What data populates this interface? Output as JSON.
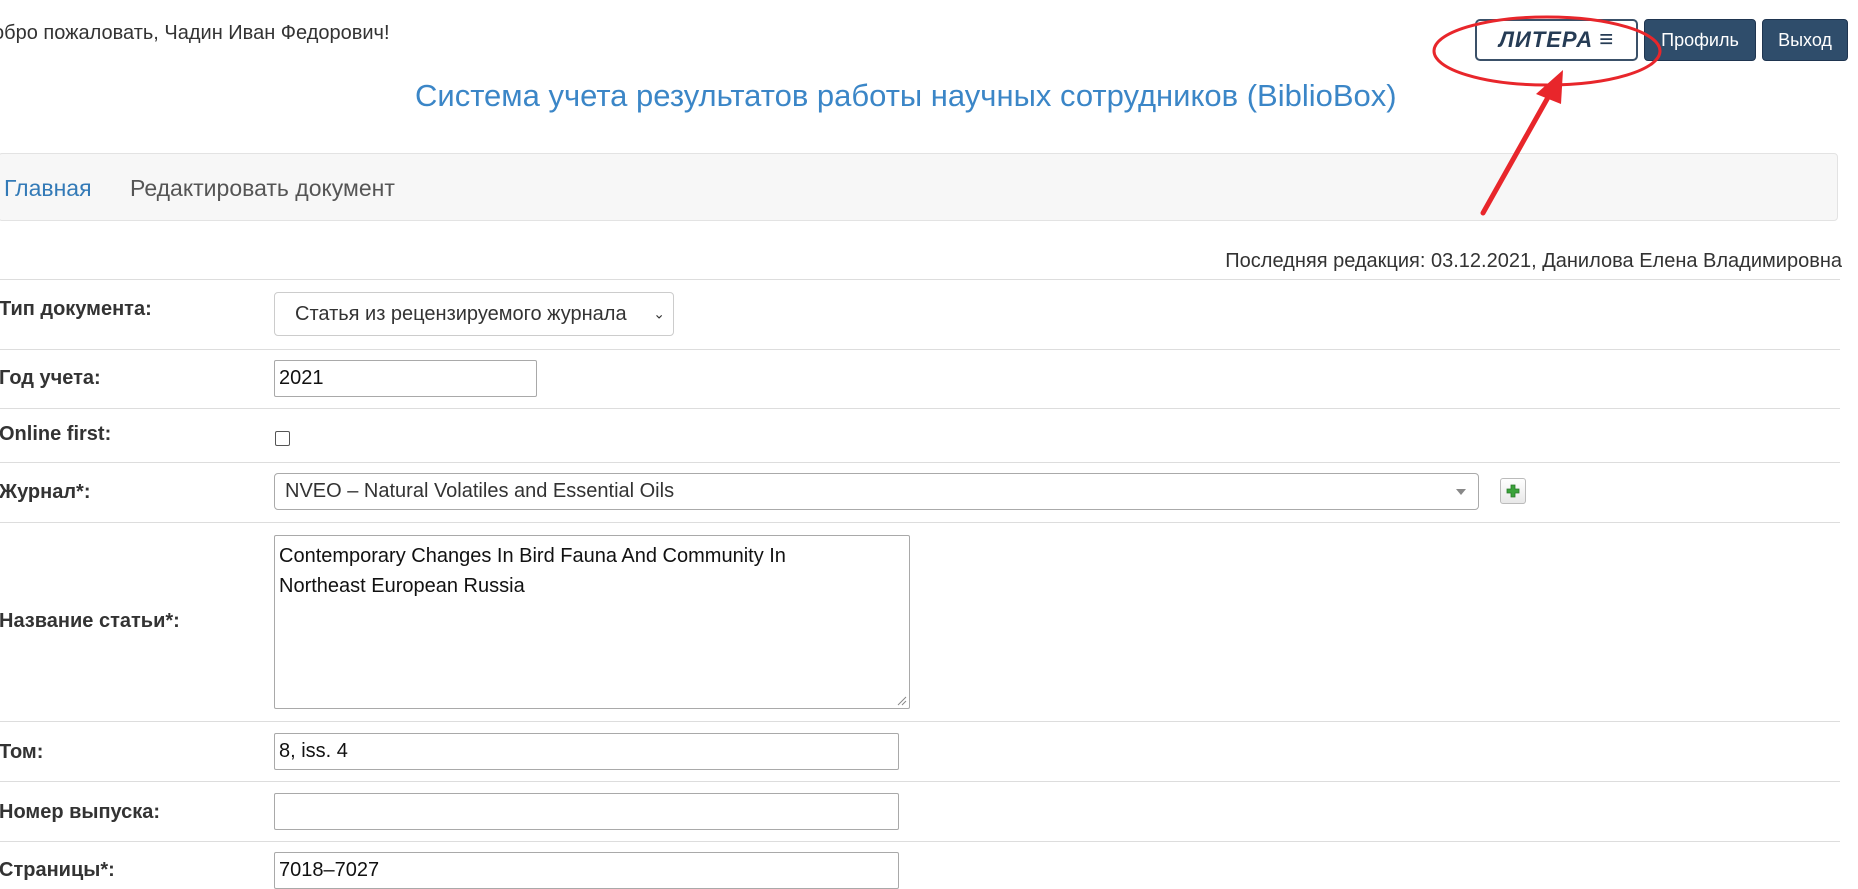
{
  "header": {
    "welcome": "обро пожаловать, Чадин Иван Федорович!",
    "litera_label": "ЛИТЕРА",
    "profile_label": "Профиль",
    "exit_label": "Выход",
    "site_title": "Система учета результатов работы научных сотрудников (BiblioBox)"
  },
  "nav": {
    "home": "Главная",
    "edit": "Редактировать документ"
  },
  "last_edit": "Последняя редакция: 03.12.2021, Данилова Елена Владимировна",
  "form": {
    "doc_type": {
      "label": "Тип документа:",
      "value": "Статья из рецензируемого журнала"
    },
    "year": {
      "label": "Год учета:",
      "value": "2021"
    },
    "online_first": {
      "label": "Online first:",
      "checked": false
    },
    "journal": {
      "label": "Журнал*:",
      "value": "NVEO – Natural Volatiles and Essential Oils"
    },
    "title": {
      "label": "Название статьи*:",
      "value": "Contemporary Changes In Bird Fauna And Community In\nNortheast European Russia"
    },
    "volume": {
      "label": "Том:",
      "value": "8, iss. 4"
    },
    "issue": {
      "label": "Номер выпуска:",
      "value": ""
    },
    "pages": {
      "label": "Страницы*:",
      "value": "7018–7027"
    }
  },
  "colors": {
    "title_blue": "#3b86c7",
    "link_blue": "#337ab7",
    "dark_button": "#2f4d6b",
    "annotation_red": "#e8262b",
    "plus_green": "#3aa33a"
  },
  "icons": [
    "hamburger-icon",
    "chevron-down-icon",
    "dropdown-arrow-icon",
    "plus-icon",
    "resize-grip-icon"
  ]
}
